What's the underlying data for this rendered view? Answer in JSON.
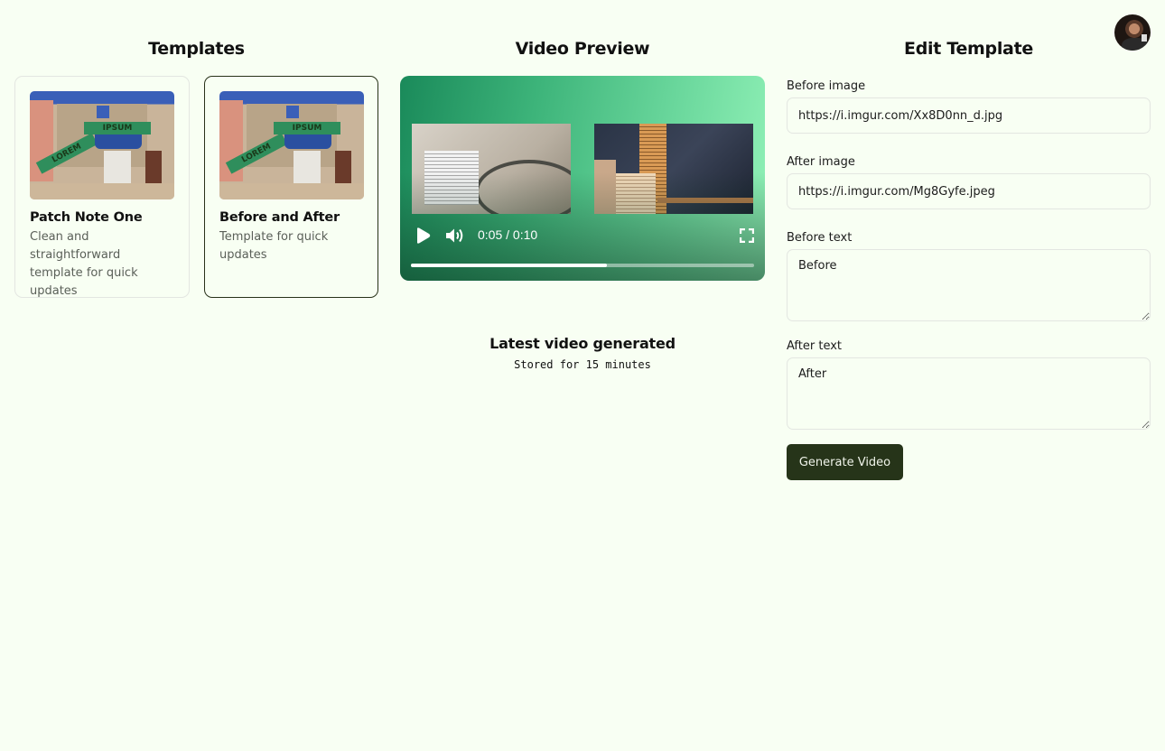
{
  "user": {
    "avatar_alt": "User avatar"
  },
  "templates": {
    "title": "Templates",
    "items": [
      {
        "name": "Patch Note One",
        "description": "Clean and straightforward template for quick updates",
        "thumb_sign_top": "IPSUM",
        "thumb_sign_side": "LOREM",
        "selected": false
      },
      {
        "name": "Before and After",
        "description": "Template for quick updates",
        "thumb_sign_top": "IPSUM",
        "thumb_sign_side": "LOREM",
        "selected": true
      }
    ]
  },
  "preview": {
    "title": "Video Preview",
    "player": {
      "current_time": "0:05",
      "duration": "0:10",
      "time_display": "0:05 / 0:10",
      "progress_fraction": 0.57,
      "icons": {
        "play": "play-icon",
        "volume": "volume-icon",
        "fullscreen": "fullscreen-icon"
      }
    },
    "latest_title": "Latest video generated",
    "latest_subtitle": "Stored for 15 minutes"
  },
  "editor": {
    "title": "Edit Template",
    "fields": {
      "before_image": {
        "label": "Before image",
        "value": "https://i.imgur.com/Xx8D0nn_d.jpg"
      },
      "after_image": {
        "label": "After image",
        "value": "https://i.imgur.com/Mg8Gyfe.jpeg"
      },
      "before_text": {
        "label": "Before text",
        "value": "Before"
      },
      "after_text": {
        "label": "After text",
        "value": "After"
      }
    },
    "generate_label": "Generate Video"
  },
  "colors": {
    "background": "#f8fff3",
    "primary_button": "#263419",
    "selected_border": "#283219",
    "video_gradient_start": "#1a8a5a",
    "video_gradient_end": "#92f2b8"
  }
}
